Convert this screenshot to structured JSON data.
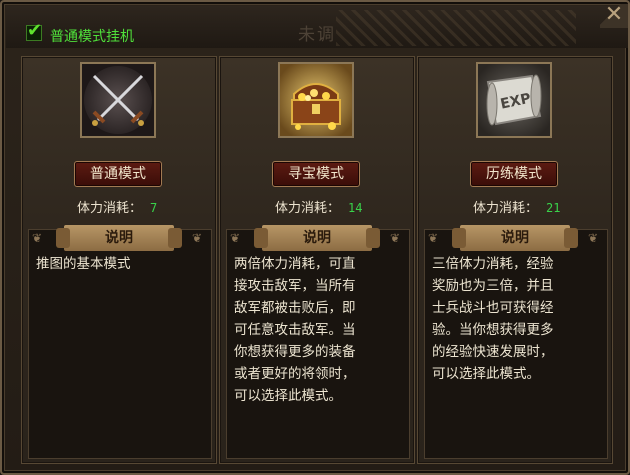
{
  "header": {
    "checkbox_label": "普通模式挂机",
    "checked": true,
    "faded_title": "未调"
  },
  "colors": {
    "check_green": "#4fe03a",
    "stamina_value": "#39d24a",
    "button_red": "#5d1b12",
    "scroll_tan": "#b79666"
  },
  "modes": [
    {
      "icon": "crossed-swords-icon",
      "button_label": "普通模式",
      "stamina_label": "体力消耗：",
      "stamina_value": "7",
      "desc_title": "说明",
      "description": "推图的基本模式"
    },
    {
      "icon": "treasure-chest-icon",
      "button_label": "寻宝模式",
      "stamina_label": "体力消耗：",
      "stamina_value": "14",
      "desc_title": "说明",
      "description": "两倍体力消耗，可直\n接攻击敌军，当所有\n敌军都被击败后，即\n可任意攻击敌军。当\n你想获得更多的装备\n或者更好的将领时，\n可以选择此模式。"
    },
    {
      "icon": "exp-scroll-icon",
      "button_label": "历练模式",
      "stamina_label": "体力消耗：",
      "stamina_value": "21",
      "desc_title": "说明",
      "description": "三倍体力消耗，经验\n奖励也为三倍，并且\n士兵战斗也可获得经\n验。当你想获得更多\n的经验快速发展时，\n可以选择此模式。"
    }
  ],
  "exp_icon_text": "EXP"
}
